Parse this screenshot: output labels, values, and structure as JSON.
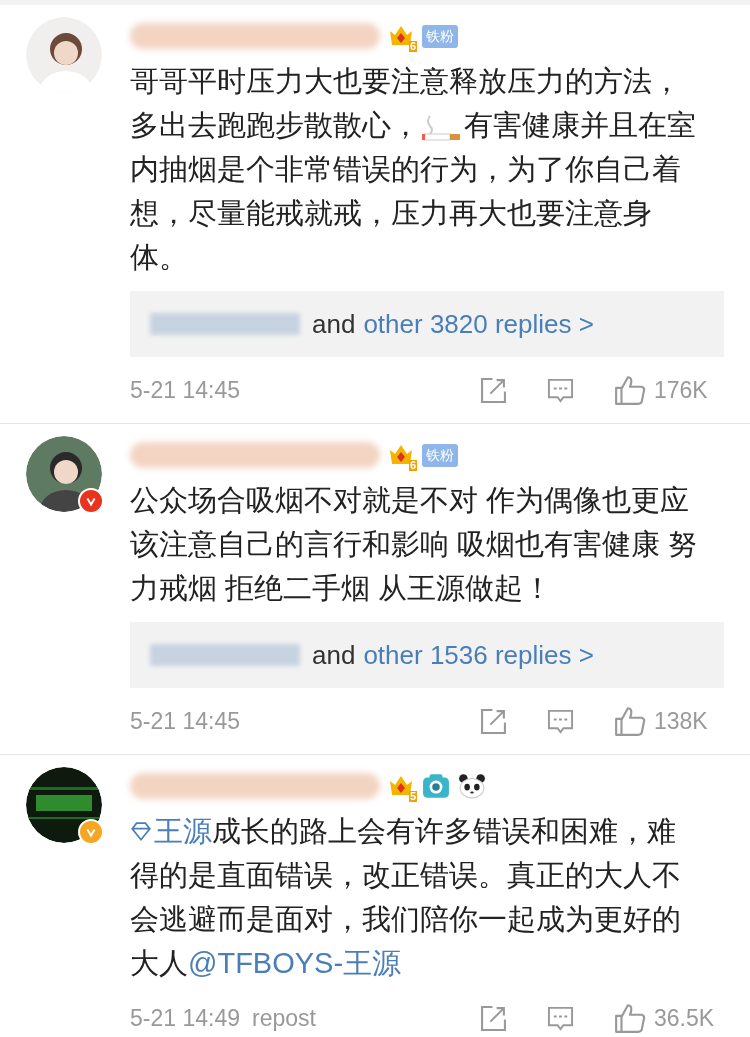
{
  "comments": [
    {
      "badges": [
        {
          "kind": "crown",
          "level": "6"
        },
        {
          "kind": "fan",
          "label": "铁粉"
        }
      ],
      "body": [
        {
          "kind": "text",
          "text": "哥哥平时压力大也要注意释放压力的方法，多出去跑跑步散散心，"
        },
        {
          "kind": "cigarette"
        },
        {
          "kind": "text",
          "text": "有害健康并且在室内抽烟是个非常错误的行为，为了你自己着想，尽量能戒就戒，压力再大也要注意身体。"
        }
      ],
      "replies": {
        "and": "and",
        "link": "other 3820 replies >"
      },
      "time": "5-21 14:45",
      "likes": "176K"
    },
    {
      "verified": {
        "color": "#e8341c"
      },
      "badges": [
        {
          "kind": "crown",
          "level": "6"
        },
        {
          "kind": "fan",
          "label": "铁粉"
        }
      ],
      "body": [
        {
          "kind": "text",
          "text": "公众场合吸烟不对就是不对 作为偶像也更应该注意自己的言行和影响 吸烟也有害健康 努力戒烟 拒绝二手烟 从王源做起！"
        }
      ],
      "replies": {
        "and": "and",
        "link": "other 1536 replies >"
      },
      "time": "5-21 14:45",
      "likes": "138K"
    },
    {
      "verified": {
        "color": "#f5a623"
      },
      "badges": [
        {
          "kind": "crown",
          "level": "5"
        },
        {
          "kind": "camera"
        },
        {
          "kind": "panda"
        }
      ],
      "body": [
        {
          "kind": "topic",
          "text": "王源"
        },
        {
          "kind": "text",
          "text": "成长的路上会有许多错误和困难，难得的是直面错误，改正错误。真正的大人不会逃避而是面对，我们陪你一起成为更好的大人"
        },
        {
          "kind": "mention",
          "text": "@TFBOYS-王源"
        }
      ],
      "time": "5-21 14:49",
      "source": "repost",
      "likes": "36.5K"
    }
  ]
}
